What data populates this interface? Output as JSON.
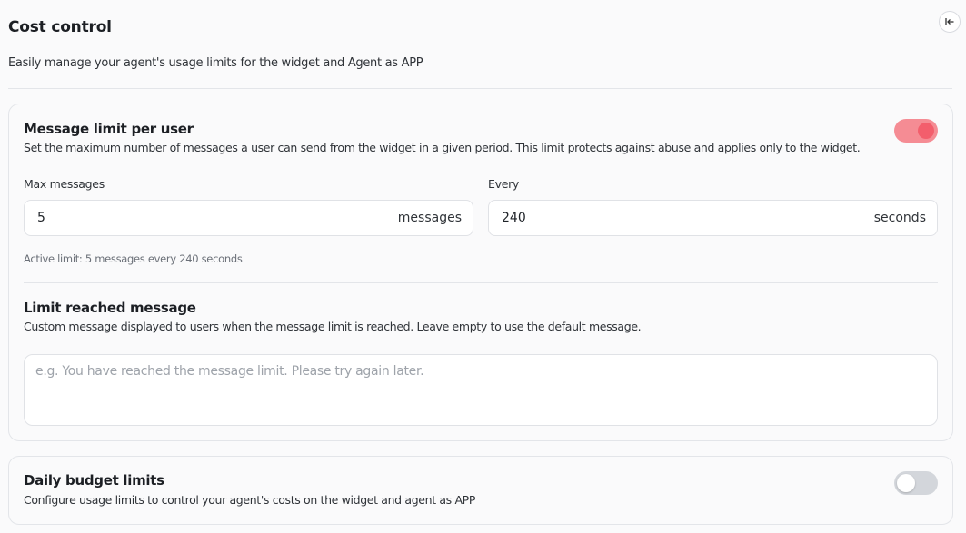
{
  "header": {
    "title": "Cost control",
    "subtitle": "Easily manage your agent's usage limits for the widget and Agent as APP",
    "collapse_icon": "collapse-panel-icon"
  },
  "message_limit": {
    "title": "Message limit per user",
    "description": "Set the maximum number of messages a user can send from the widget in a given period. This limit protects against abuse and applies only to the widget.",
    "enabled": true,
    "max_messages_label": "Max messages",
    "max_messages_value": "5",
    "max_messages_suffix": "messages",
    "every_label": "Every",
    "every_value": "240",
    "every_suffix": "seconds",
    "active_limit_text": "Active limit: 5 messages every 240 seconds"
  },
  "limit_reached": {
    "title": "Limit reached message",
    "description": "Custom message displayed to users when the message limit is reached. Leave empty to use the default message.",
    "placeholder": "e.g. You have reached the message limit. Please try again later."
  },
  "daily_budget": {
    "title": "Daily budget limits",
    "description": "Configure usage limits to control your agent's costs on the widget and agent as APP",
    "enabled": false
  },
  "colors": {
    "toggle_on": "#f58c94",
    "toggle_on_knob": "#f35e6c",
    "toggle_off": "#d3d6db"
  }
}
